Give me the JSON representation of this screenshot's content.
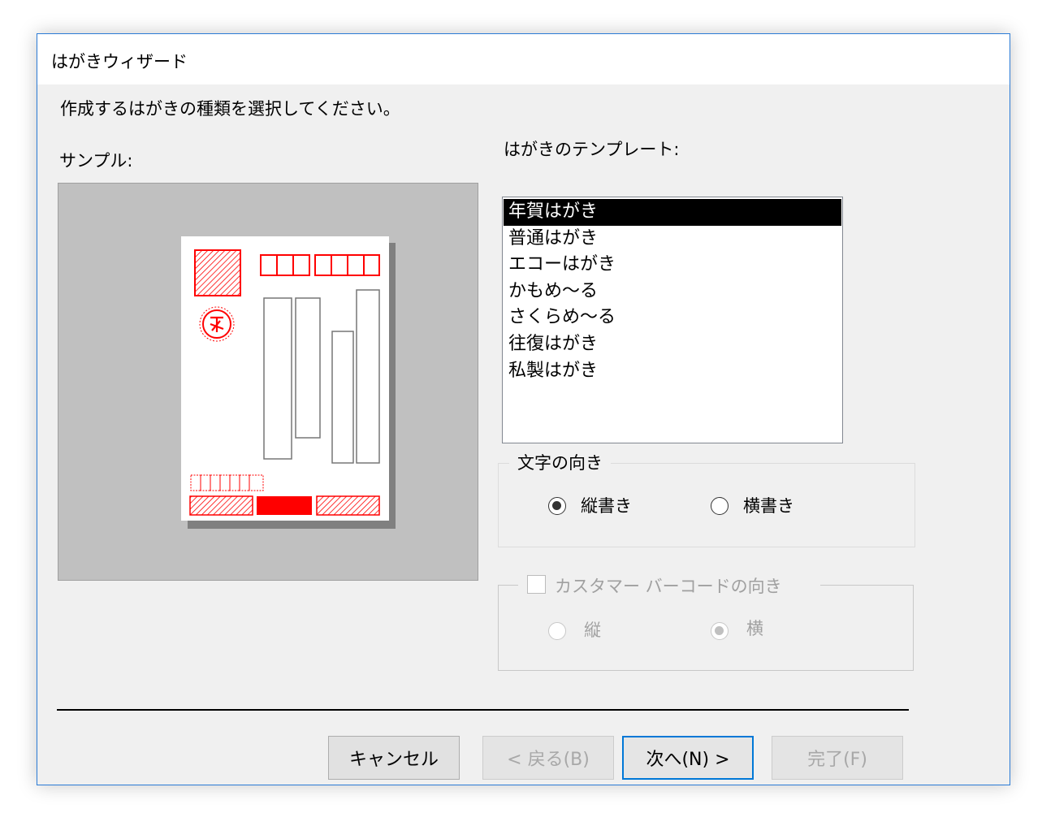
{
  "window": {
    "title": "はがきウィザード",
    "instruction": "作成するはがきの種類を選択してください。"
  },
  "sample": {
    "label": "サンプル:"
  },
  "templates": {
    "label": "はがきのテンプレート:",
    "items": [
      "年賀はがき",
      "普通はがき",
      "エコーはがき",
      "かもめ～る",
      "さくらめ～る",
      "往復はがき",
      "私製はがき"
    ],
    "selected_index": 0
  },
  "text_direction": {
    "legend": "文字の向き",
    "options": [
      {
        "label": "縦書き",
        "checked": true
      },
      {
        "label": "横書き",
        "checked": false
      }
    ]
  },
  "barcode_direction": {
    "legend": "カスタマー バーコードの向き",
    "checkbox_checked": false,
    "enabled": false,
    "options": [
      {
        "label": "縦",
        "checked": false
      },
      {
        "label": "横",
        "checked": true
      }
    ]
  },
  "buttons": {
    "cancel": "キャンセル",
    "back": "< 戻る(B)",
    "next": "次へ(N) >",
    "finish": "完了(F)"
  },
  "colors": {
    "accent": "#0078d7",
    "sample_red": "#ff0000",
    "selection": "#000000"
  }
}
